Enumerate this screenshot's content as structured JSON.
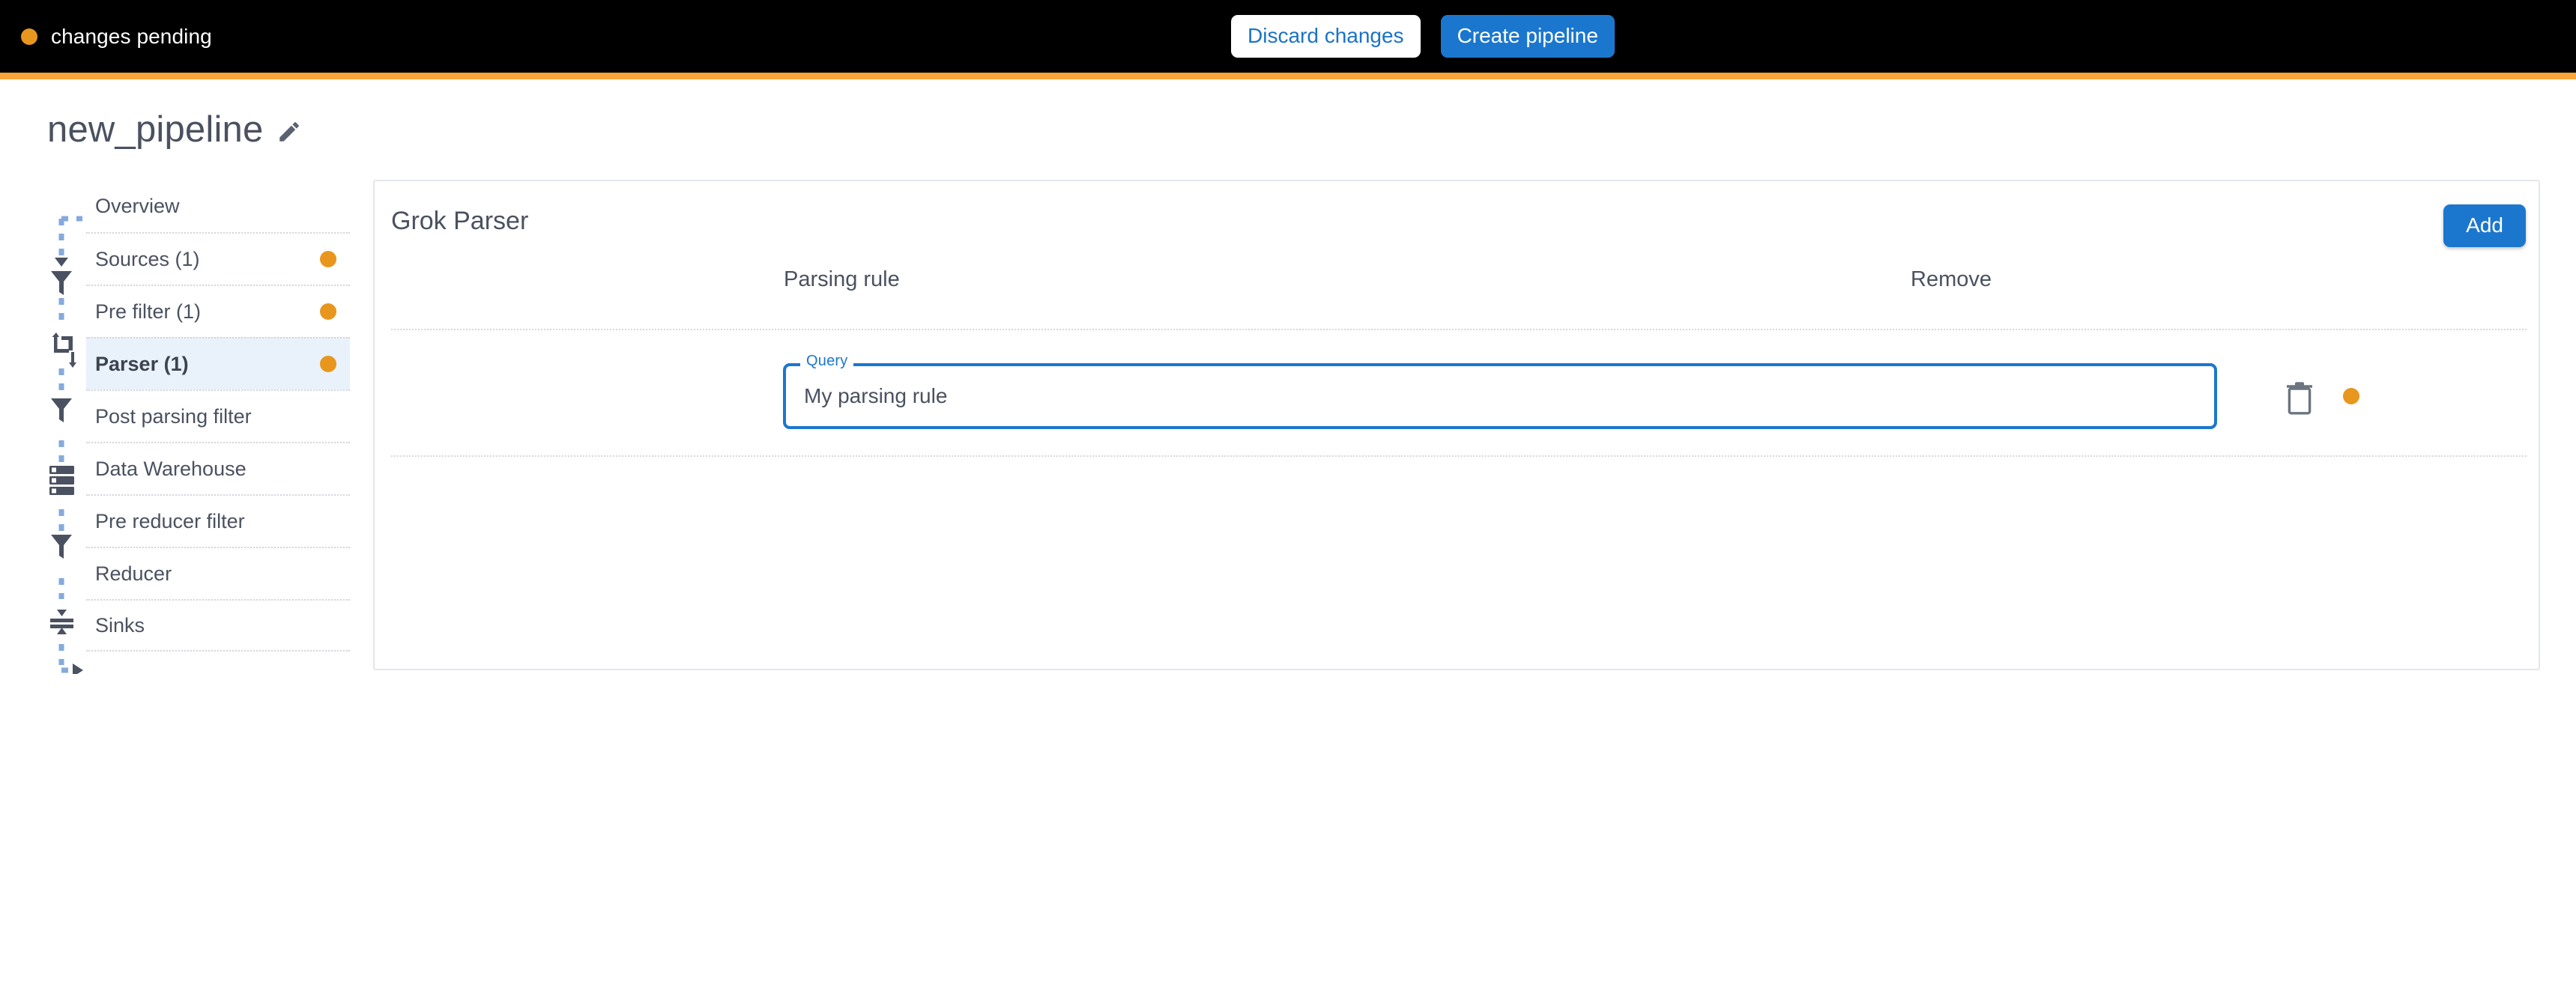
{
  "topbar": {
    "status_text": "changes pending",
    "status_dot_color": "#E8961E",
    "background_color": "#000000",
    "accent_stripe_color": "#FCA639",
    "discard_label": "Discard changes",
    "create_label": "Create pipeline",
    "primary_color": "#1B77CE"
  },
  "page": {
    "title": "new_pipeline",
    "edit_icon": "pencil-icon"
  },
  "sidebar": {
    "items": [
      {
        "label": "Overview",
        "dot": false,
        "selected": false,
        "icon": null
      },
      {
        "label": "Sources (1)",
        "dot": true,
        "selected": false,
        "icon": "arrow-right-icon"
      },
      {
        "label": "Pre filter (1)",
        "dot": true,
        "selected": false,
        "icon": "funnel-icon"
      },
      {
        "label": "Parser (1)",
        "dot": true,
        "selected": true,
        "icon": "transform-icon"
      },
      {
        "label": "Post parsing filter",
        "dot": false,
        "selected": false,
        "icon": "funnel-icon"
      },
      {
        "label": "Data Warehouse",
        "dot": false,
        "selected": false,
        "icon": "database-icon"
      },
      {
        "label": "Pre reducer filter",
        "dot": false,
        "selected": false,
        "icon": "funnel-icon"
      },
      {
        "label": "Reducer",
        "dot": false,
        "selected": false,
        "icon": "reduce-icon"
      },
      {
        "label": "Sinks",
        "dot": false,
        "selected": false,
        "icon": "arrow-right-icon"
      }
    ],
    "connector_color": "#85AADC",
    "icon_color": "#4A5160",
    "selected_background": "#E9F1FB"
  },
  "panel": {
    "title": "Grok Parser",
    "add_label": "Add",
    "columns": {
      "parsing_rule": "Parsing rule",
      "remove": "Remove"
    },
    "rows": [
      {
        "query_label": "Query",
        "query_value": "My parsing rule",
        "remove_icon": "trash-icon",
        "status_dot": true
      }
    ]
  }
}
